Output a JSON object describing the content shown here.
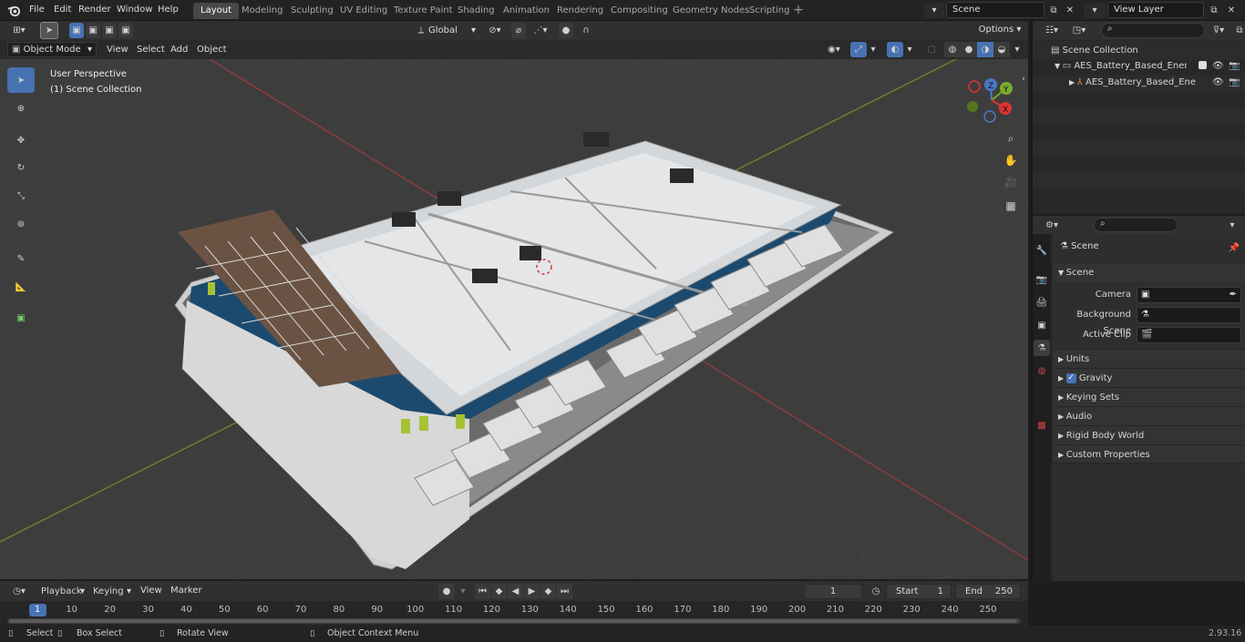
{
  "topbar": {
    "menus": [
      "File",
      "Edit",
      "Render",
      "Window",
      "Help"
    ],
    "workspaces": [
      "Layout",
      "Modeling",
      "Sculpting",
      "UV Editing",
      "Texture Paint",
      "Shading",
      "Animation",
      "Rendering",
      "Compositing",
      "Geometry Nodes",
      "Scripting"
    ],
    "scene": "Scene",
    "view_layer": "View Layer"
  },
  "viewport": {
    "mode": "Object Mode",
    "menus": [
      "View",
      "Select",
      "Add",
      "Object"
    ],
    "orientation": "Global",
    "options": "Options",
    "overlay_title": "User Perspective",
    "overlay_sub": "(1) Scene Collection",
    "gizmo": {
      "z": "Z",
      "y": "Y",
      "x": "X"
    }
  },
  "outliner": {
    "root": "Scene Collection",
    "items": [
      "AES_Battery_Based_Energy_S",
      "AES_Battery_Based_Ene"
    ]
  },
  "properties": {
    "title": "Scene",
    "section": "Scene",
    "fields": [
      {
        "label": "Camera"
      },
      {
        "label": "Background Scene"
      },
      {
        "label": "Active Clip"
      }
    ],
    "panels": [
      "Units",
      "Gravity",
      "Keying Sets",
      "Audio",
      "Rigid Body World",
      "Custom Properties"
    ],
    "gravity_checked": true
  },
  "timeline": {
    "menus": [
      "Playback",
      "Keying",
      "View",
      "Marker"
    ],
    "current_frame": "1",
    "start_label": "Start",
    "start": "1",
    "end_label": "End",
    "end": "250",
    "ticks": [
      "1",
      "10",
      "20",
      "30",
      "40",
      "50",
      "60",
      "70",
      "80",
      "90",
      "100",
      "110",
      "120",
      "130",
      "140",
      "150",
      "160",
      "170",
      "180",
      "190",
      "200",
      "210",
      "220",
      "230",
      "240",
      "250"
    ]
  },
  "statusbar": {
    "items": [
      "Select",
      "Box Select",
      "Rotate View",
      "Object Context Menu"
    ],
    "version": "2.93.16"
  }
}
